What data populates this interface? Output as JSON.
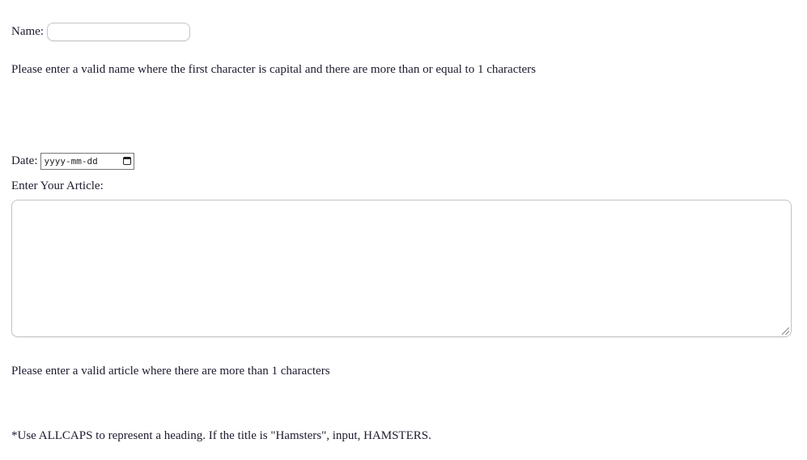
{
  "form": {
    "name_label": "Name:",
    "name_value": "",
    "name_error": "Please enter a valid name where the first character is capital and there are more than or equal to 1 characters",
    "date_label": "Date:",
    "date_placeholder": "yyyy-mm-dd",
    "article_label": "Enter Your Article:",
    "article_value": "",
    "article_error": "Please enter a valid article where there are more than 1 characters",
    "heading_note": "*Use ALLCAPS to represent a heading. If the title is \"Hamsters\", input, HAMSTERS."
  },
  "icons": {
    "date_picker": "calendar-icon",
    "textarea_resize": "resize-grip-icon"
  }
}
